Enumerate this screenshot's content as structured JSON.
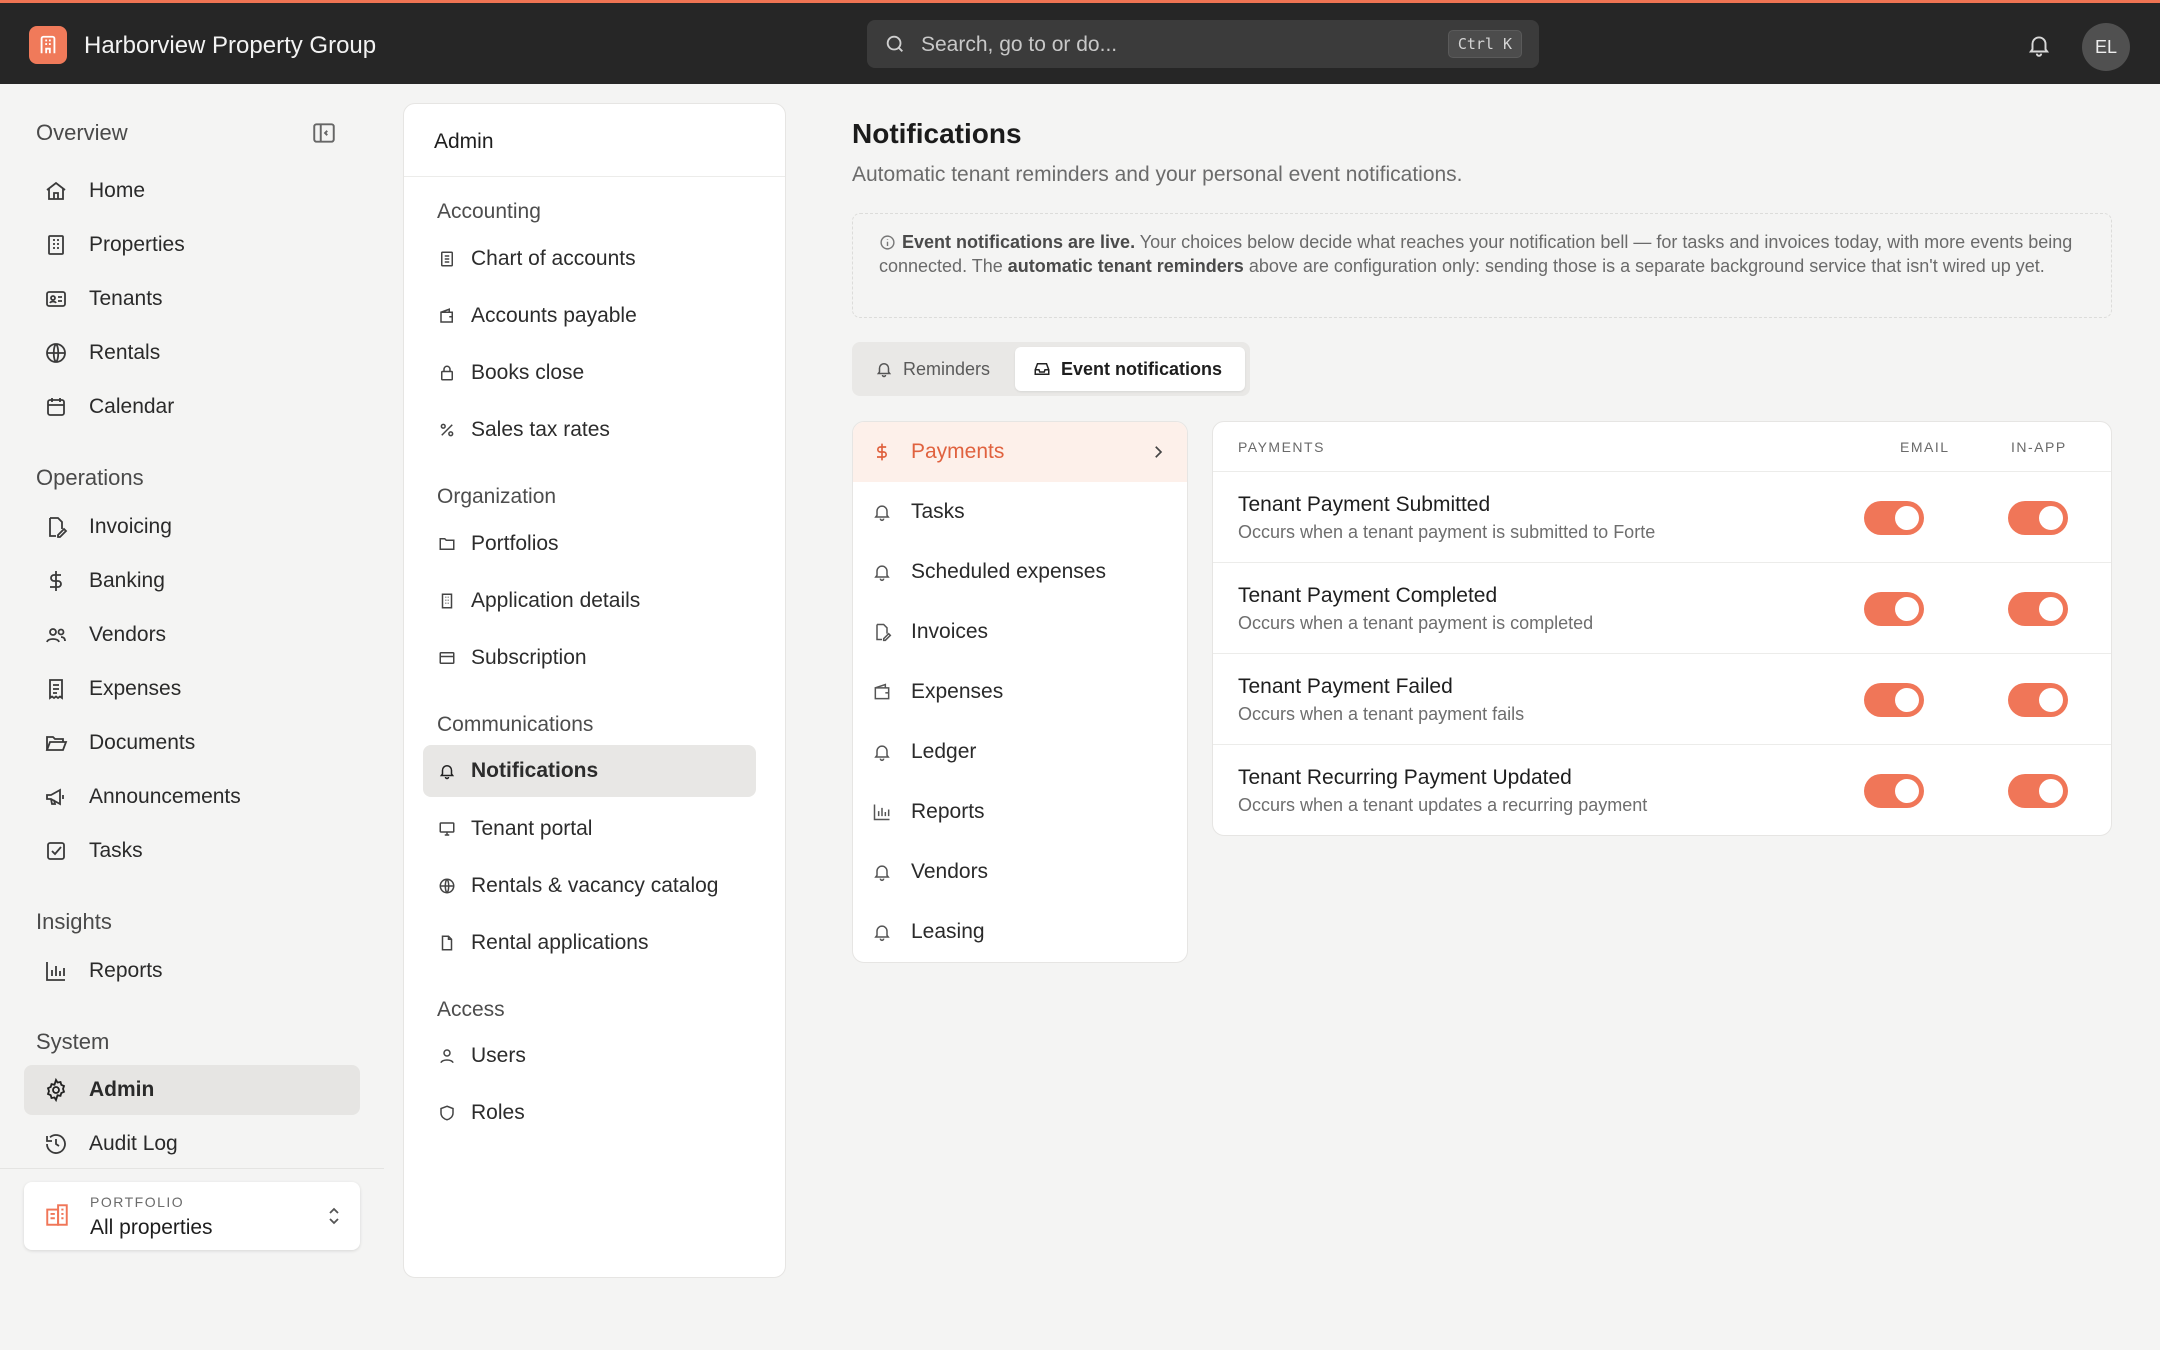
{
  "colors": {
    "accent": "#f07658",
    "topbar": "#262626",
    "active_category_bg": "#fdf0ea"
  },
  "topbar": {
    "org_name": "Harborview Property Group",
    "logo_icon": "building-icon",
    "search_placeholder": "Search, go to or do...",
    "search_shortcut": "Ctrl K",
    "avatar_initials": "EL"
  },
  "sidebar": {
    "overview_label": "Overview",
    "overview": [
      {
        "label": "Home",
        "icon": "home-icon"
      },
      {
        "label": "Properties",
        "icon": "building-icon"
      },
      {
        "label": "Tenants",
        "icon": "id-card-icon"
      },
      {
        "label": "Rentals",
        "icon": "globe-icon"
      },
      {
        "label": "Calendar",
        "icon": "calendar-icon"
      }
    ],
    "operations_label": "Operations",
    "operations": [
      {
        "label": "Invoicing",
        "icon": "invoice-icon"
      },
      {
        "label": "Banking",
        "icon": "dollar-icon"
      },
      {
        "label": "Vendors",
        "icon": "users-icon"
      },
      {
        "label": "Expenses",
        "icon": "receipt-icon"
      },
      {
        "label": "Documents",
        "icon": "folder-open-icon"
      },
      {
        "label": "Announcements",
        "icon": "megaphone-icon"
      },
      {
        "label": "Tasks",
        "icon": "checkbox-icon"
      }
    ],
    "insights_label": "Insights",
    "insights": [
      {
        "label": "Reports",
        "icon": "bar-chart-icon"
      }
    ],
    "system_label": "System",
    "system": [
      {
        "label": "Admin",
        "icon": "gear-icon",
        "active": true
      },
      {
        "label": "Audit Log",
        "icon": "history-icon"
      }
    ],
    "portfolio": {
      "label": "PORTFOLIO",
      "value": "All properties"
    }
  },
  "admin": {
    "title": "Admin",
    "accounting_label": "Accounting",
    "accounting": [
      "Chart of accounts",
      "Accounts payable",
      "Books close",
      "Sales tax rates"
    ],
    "organization_label": "Organization",
    "organization": [
      "Portfolios",
      "Application details",
      "Subscription"
    ],
    "communications_label": "Communications",
    "communications": [
      "Notifications",
      "Tenant portal",
      "Rentals & vacancy catalog",
      "Rental applications"
    ],
    "access_label": "Access",
    "access": [
      "Users",
      "Roles"
    ]
  },
  "main": {
    "title": "Notifications",
    "subtitle": "Automatic tenant reminders and your personal event notifications.",
    "info": {
      "bold1": "Event notifications are live.",
      "text1": " Your choices below decide what reaches your notification bell — for tasks and invoices today, with more events being connected. The ",
      "bold2": "automatic tenant reminders",
      "text2": " above are configuration only: sending those is a separate background service that isn't wired up yet."
    },
    "tabs": [
      {
        "label": "Reminders",
        "active": false
      },
      {
        "label": "Event notifications",
        "active": true
      }
    ],
    "categories": [
      "Payments",
      "Tasks",
      "Scheduled expenses",
      "Invoices",
      "Expenses",
      "Ledger",
      "Reports",
      "Vendors",
      "Leasing"
    ],
    "table": {
      "header": "PAYMENTS",
      "email_label": "EMAIL",
      "inapp_label": "IN-APP",
      "rows": [
        {
          "title": "Tenant Payment Submitted",
          "desc": "Occurs when a tenant payment is submitted to Forte",
          "email": true,
          "inapp": true
        },
        {
          "title": "Tenant Payment Completed",
          "desc": "Occurs when a tenant payment is completed",
          "email": true,
          "inapp": true
        },
        {
          "title": "Tenant Payment Failed",
          "desc": "Occurs when a tenant payment fails",
          "email": true,
          "inapp": true
        },
        {
          "title": "Tenant Recurring Payment Updated",
          "desc": "Occurs when a tenant updates a recurring payment",
          "email": true,
          "inapp": true
        }
      ]
    }
  }
}
